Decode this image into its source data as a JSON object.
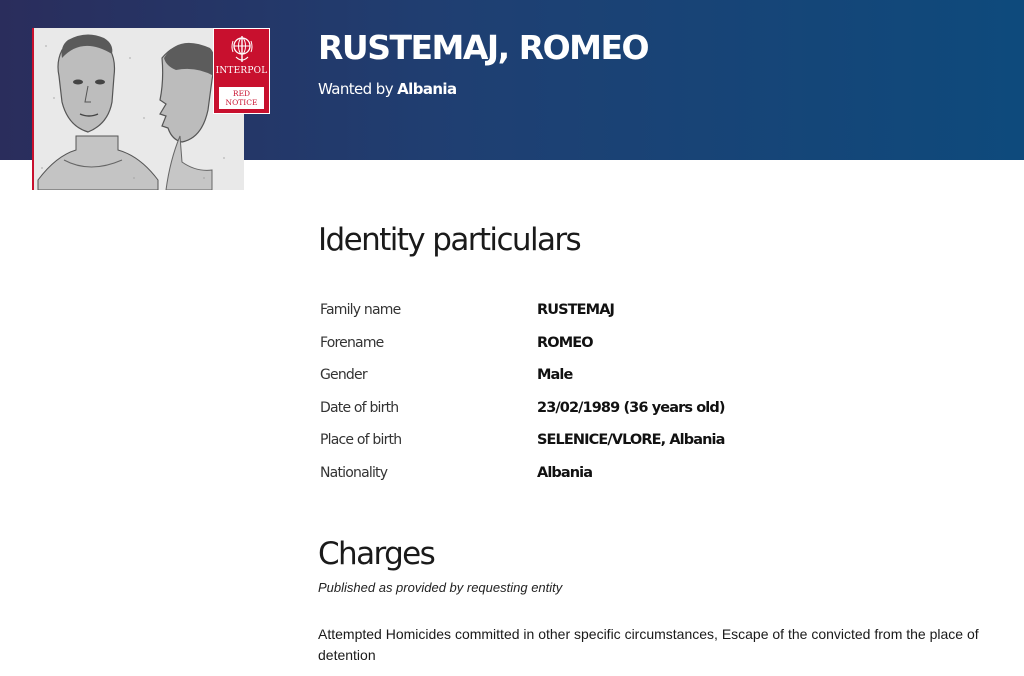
{
  "header": {
    "name": "RUSTEMAJ, ROMEO",
    "wanted_prefix": "Wanted by",
    "wanted_country": "Albania"
  },
  "badge": {
    "org": "INTERPOL",
    "notice_line1": "RED",
    "notice_line2": "NOTICE",
    "icon": "interpol-globe-icon"
  },
  "identity": {
    "title": "Identity particulars",
    "rows": [
      {
        "label": "Family name",
        "value": "RUSTEMAJ"
      },
      {
        "label": "Forename",
        "value": "ROMEO"
      },
      {
        "label": "Gender",
        "value": "Male"
      },
      {
        "label": "Date of birth",
        "value": "23/02/1989 (36 years old)"
      },
      {
        "label": "Place of birth",
        "value": "SELENICE/VLORE, Albania"
      },
      {
        "label": "Nationality",
        "value": "Albania"
      }
    ]
  },
  "charges": {
    "title": "Charges",
    "note": "Published as provided by requesting entity",
    "text": "Attempted Homicides committed in other specific circumstances, Escape of the convicted from the place of detention"
  },
  "colors": {
    "header_start": "#2a2d5c",
    "header_end": "#0e4a7c",
    "interpol_red": "#c8102e"
  }
}
